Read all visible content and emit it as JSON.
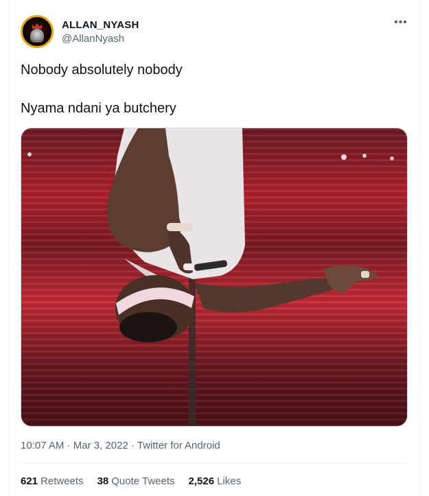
{
  "author": {
    "display_name": "ALLAN_NYASH",
    "handle": "@AllanNyash"
  },
  "more_icon": "more-horizontal-icon",
  "tweet": {
    "lines": [
      "Nobody absolutely nobody",
      "Nyama ndani ya butchery"
    ]
  },
  "meta": {
    "time": "10:07 AM",
    "date": "Mar 3, 2022",
    "source": "Twitter for Android"
  },
  "stats": {
    "retweets": {
      "count": "621",
      "label": "Retweets"
    },
    "quotes": {
      "count": "38",
      "label": "Quote Tweets"
    },
    "likes": {
      "count": "2,526",
      "label": "Likes"
    }
  },
  "colors": {
    "text": "#0f1419",
    "secondary": "#536471",
    "border": "#eff3f4",
    "avatar_ring": "#e8a317"
  }
}
